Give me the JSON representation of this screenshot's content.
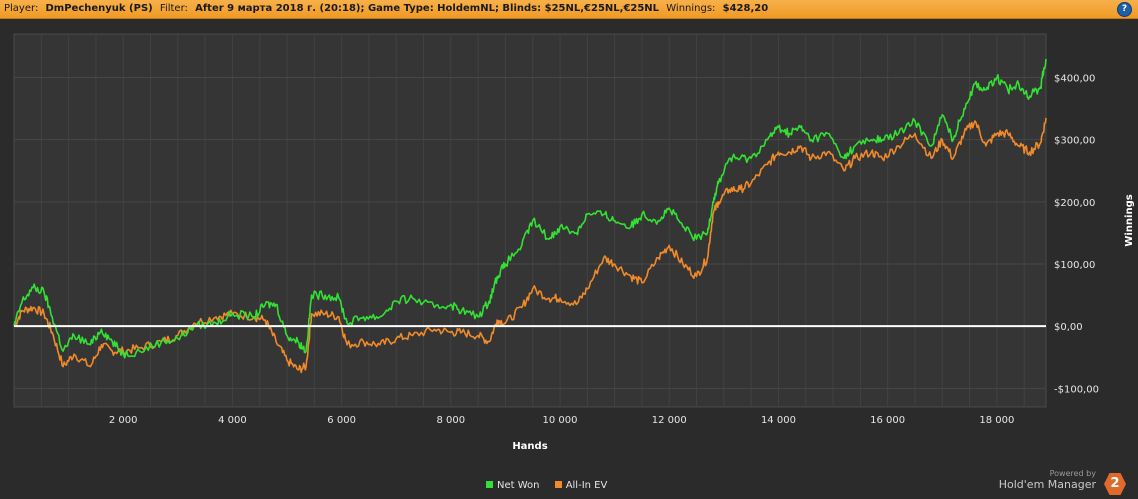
{
  "header": {
    "player_label": "Player:",
    "player_value": "DmPechenyuk (PS)",
    "filter_label": "Filter:",
    "filter_value": "After 9 марта 2018 г. (20:18); Game Type: HoldemNL; Blinds: $25NL,€25NL,€25NL",
    "winnings_label": "Winnings:",
    "winnings_value": "$428,20",
    "help_glyph": "?"
  },
  "brand": {
    "powered": "Powered by",
    "name": "Hold'em Manager",
    "logo_text": "2"
  },
  "colors": {
    "background": "#2b2b2b",
    "net_won": "#33e033",
    "allin_ev": "#f08a2a",
    "zero_line": "#ffffff",
    "header_bar": "#f5a83a"
  },
  "chart_data": {
    "type": "line",
    "xlabel": "Hands",
    "ylabel": "Winnings",
    "xlim": [
      0,
      18900
    ],
    "ylim": [
      -130,
      470
    ],
    "x_ticks": [
      2000,
      4000,
      6000,
      8000,
      10000,
      12000,
      14000,
      16000,
      18000
    ],
    "x_tick_labels": [
      "2 000",
      "4 000",
      "6 000",
      "8 000",
      "10 000",
      "12 000",
      "14 000",
      "16 000",
      "18 000"
    ],
    "y_ticks": [
      -100,
      0,
      100,
      200,
      300,
      400
    ],
    "y_tick_labels": [
      "-$100,00",
      "$0,00",
      "$100,00",
      "$200,00",
      "$300,00",
      "$400,00"
    ],
    "grid": true,
    "legend_position": "bottom-center",
    "series": [
      {
        "name": "Net Won",
        "color": "#33e033",
        "points": [
          [
            0,
            0
          ],
          [
            150,
            40
          ],
          [
            350,
            62
          ],
          [
            550,
            55
          ],
          [
            700,
            15
          ],
          [
            900,
            -40
          ],
          [
            1100,
            -15
          ],
          [
            1400,
            -30
          ],
          [
            1600,
            -5
          ],
          [
            1800,
            -25
          ],
          [
            2000,
            -45
          ],
          [
            2300,
            -40
          ],
          [
            2700,
            -25
          ],
          [
            3000,
            -20
          ],
          [
            3300,
            0
          ],
          [
            3700,
            5
          ],
          [
            4000,
            20
          ],
          [
            4400,
            15
          ],
          [
            4600,
            35
          ],
          [
            4800,
            35
          ],
          [
            5000,
            -15
          ],
          [
            5200,
            -25
          ],
          [
            5350,
            -40
          ],
          [
            5450,
            50
          ],
          [
            5700,
            50
          ],
          [
            5950,
            45
          ],
          [
            6100,
            5
          ],
          [
            6400,
            15
          ],
          [
            6700,
            15
          ],
          [
            7000,
            40
          ],
          [
            7300,
            45
          ],
          [
            7700,
            30
          ],
          [
            8000,
            35
          ],
          [
            8200,
            25
          ],
          [
            8500,
            15
          ],
          [
            8700,
            40
          ],
          [
            8850,
            80
          ],
          [
            9000,
            100
          ],
          [
            9300,
            130
          ],
          [
            9500,
            170
          ],
          [
            9800,
            140
          ],
          [
            10000,
            160
          ],
          [
            10300,
            150
          ],
          [
            10500,
            180
          ],
          [
            10800,
            180
          ],
          [
            11000,
            170
          ],
          [
            11300,
            160
          ],
          [
            11500,
            180
          ],
          [
            11800,
            170
          ],
          [
            12000,
            190
          ],
          [
            12250,
            160
          ],
          [
            12500,
            140
          ],
          [
            12700,
            150
          ],
          [
            12800,
            200
          ],
          [
            12900,
            230
          ],
          [
            13100,
            270
          ],
          [
            13300,
            270
          ],
          [
            13500,
            270
          ],
          [
            13800,
            300
          ],
          [
            14000,
            320
          ],
          [
            14200,
            310
          ],
          [
            14400,
            320
          ],
          [
            14600,
            300
          ],
          [
            14900,
            310
          ],
          [
            15200,
            270
          ],
          [
            15400,
            290
          ],
          [
            15700,
            300
          ],
          [
            15900,
            300
          ],
          [
            16200,
            310
          ],
          [
            16500,
            330
          ],
          [
            16800,
            290
          ],
          [
            17000,
            340
          ],
          [
            17200,
            300
          ],
          [
            17400,
            350
          ],
          [
            17600,
            390
          ],
          [
            17800,
            380
          ],
          [
            18000,
            400
          ],
          [
            18200,
            380
          ],
          [
            18400,
            390
          ],
          [
            18600,
            370
          ],
          [
            18800,
            385
          ],
          [
            18900,
            430
          ]
        ]
      },
      {
        "name": "All-In EV",
        "color": "#f08a2a",
        "points": [
          [
            0,
            0
          ],
          [
            150,
            25
          ],
          [
            350,
            30
          ],
          [
            550,
            20
          ],
          [
            700,
            -10
          ],
          [
            900,
            -65
          ],
          [
            1100,
            -45
          ],
          [
            1400,
            -65
          ],
          [
            1600,
            -30
          ],
          [
            1800,
            -40
          ],
          [
            2000,
            -40
          ],
          [
            2300,
            -35
          ],
          [
            2700,
            -25
          ],
          [
            3000,
            -15
          ],
          [
            3300,
            5
          ],
          [
            3700,
            15
          ],
          [
            4000,
            20
          ],
          [
            4400,
            15
          ],
          [
            4600,
            10
          ],
          [
            4800,
            -25
          ],
          [
            5000,
            -55
          ],
          [
            5200,
            -70
          ],
          [
            5350,
            -65
          ],
          [
            5450,
            20
          ],
          [
            5700,
            20
          ],
          [
            5950,
            15
          ],
          [
            6100,
            -30
          ],
          [
            6400,
            -25
          ],
          [
            6700,
            -30
          ],
          [
            7000,
            -20
          ],
          [
            7300,
            -15
          ],
          [
            7700,
            -5
          ],
          [
            8000,
            -10
          ],
          [
            8200,
            -10
          ],
          [
            8500,
            -15
          ],
          [
            8700,
            -25
          ],
          [
            8850,
            10
          ],
          [
            9000,
            5
          ],
          [
            9300,
            30
          ],
          [
            9500,
            60
          ],
          [
            9800,
            45
          ],
          [
            10000,
            45
          ],
          [
            10300,
            35
          ],
          [
            10500,
            60
          ],
          [
            10800,
            110
          ],
          [
            11000,
            100
          ],
          [
            11300,
            80
          ],
          [
            11500,
            70
          ],
          [
            11800,
            110
          ],
          [
            12000,
            130
          ],
          [
            12250,
            100
          ],
          [
            12500,
            80
          ],
          [
            12700,
            110
          ],
          [
            12800,
            180
          ],
          [
            12900,
            200
          ],
          [
            13100,
            220
          ],
          [
            13300,
            220
          ],
          [
            13500,
            230
          ],
          [
            13800,
            260
          ],
          [
            14000,
            280
          ],
          [
            14200,
            280
          ],
          [
            14400,
            290
          ],
          [
            14600,
            270
          ],
          [
            14900,
            280
          ],
          [
            15200,
            250
          ],
          [
            15400,
            270
          ],
          [
            15700,
            280
          ],
          [
            15900,
            270
          ],
          [
            16200,
            290
          ],
          [
            16500,
            310
          ],
          [
            16800,
            270
          ],
          [
            17000,
            300
          ],
          [
            17200,
            270
          ],
          [
            17400,
            310
          ],
          [
            17600,
            330
          ],
          [
            17800,
            290
          ],
          [
            18000,
            310
          ],
          [
            18200,
            310
          ],
          [
            18400,
            290
          ],
          [
            18600,
            280
          ],
          [
            18800,
            295
          ],
          [
            18900,
            335
          ]
        ]
      }
    ]
  }
}
